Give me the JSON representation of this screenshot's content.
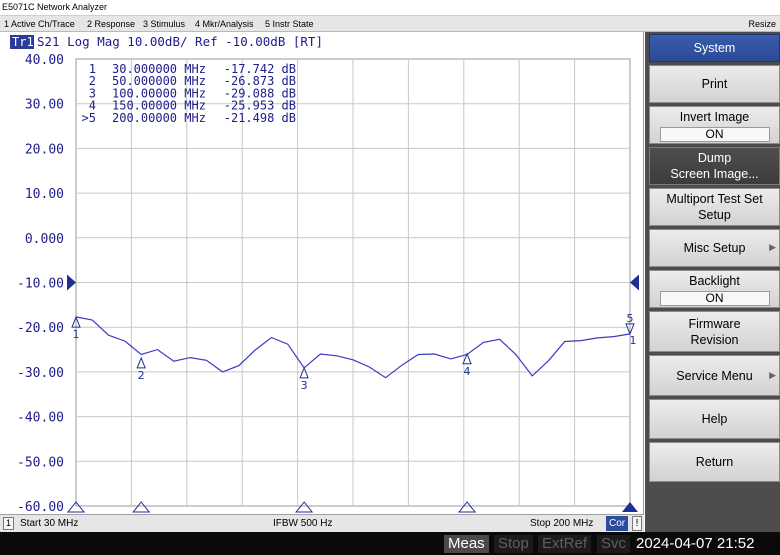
{
  "window": {
    "title": "E5071C Network Analyzer"
  },
  "menu": {
    "items": [
      "1 Active Ch/Trace",
      "2 Response",
      "3 Stimulus",
      "4 Mkr/Analysis",
      "5 Instr State"
    ],
    "resize_label": "Resize"
  },
  "trace": {
    "id_label": "Tr1",
    "header": "S21 Log Mag 10.00dB/ Ref -10.00dB [RT]"
  },
  "markers": [
    {
      "num": "1",
      "active": false,
      "freq": "30.000000 MHz",
      "value": "-17.742 dB",
      "freq_mhz": 30,
      "db": -17.742
    },
    {
      "num": "2",
      "active": false,
      "freq": "50.000000 MHz",
      "value": "-26.873 dB",
      "freq_mhz": 50,
      "db": -26.873
    },
    {
      "num": "3",
      "active": false,
      "freq": "100.00000 MHz",
      "value": "-29.088 dB",
      "freq_mhz": 100,
      "db": -29.088
    },
    {
      "num": "4",
      "active": false,
      "freq": "150.00000 MHz",
      "value": "-25.953 dB",
      "freq_mhz": 150,
      "db": -25.953
    },
    {
      "num": "5",
      "active": true,
      "freq": "200.00000 MHz",
      "value": "-21.498 dB",
      "freq_mhz": 200,
      "db": -21.498
    }
  ],
  "chart_data": {
    "type": "line",
    "title": "S21 Log Mag 10.00dB/ Ref -10.00dB [RT]",
    "xlabel": "",
    "ylabel": "",
    "xlim": [
      30,
      200
    ],
    "ylim": [
      -60,
      40
    ],
    "reference_level": -10,
    "y_ticks": [
      "40.00",
      "30.00",
      "20.00",
      "10.00",
      "0.000",
      "-10.00",
      "-20.00",
      "-30.00",
      "-40.00",
      "-50.00",
      "-60.00"
    ],
    "grid": true,
    "series": [
      {
        "color": "#3b3bc0",
        "x": [
          30,
          35,
          40,
          45,
          50,
          55,
          60,
          65,
          70,
          75,
          80,
          85,
          90,
          95,
          100,
          105,
          110,
          115,
          120,
          125,
          130,
          135,
          140,
          145,
          150,
          155,
          160,
          165,
          170,
          175,
          180,
          185,
          190,
          195,
          200
        ],
        "y": [
          -17.7,
          -18.4,
          -21.8,
          -23.1,
          -26.1,
          -25.0,
          -27.6,
          -26.8,
          -27.4,
          -30.0,
          -28.6,
          -25.1,
          -22.3,
          -23.8,
          -29.1,
          -26.0,
          -26.4,
          -27.3,
          -28.9,
          -31.3,
          -28.5,
          -26.1,
          -26.0,
          -27.1,
          -26.1,
          -23.4,
          -22.7,
          -26.1,
          -30.9,
          -27.5,
          -23.2,
          -23.0,
          -22.4,
          -22.1,
          -21.5
        ]
      }
    ]
  },
  "footer": {
    "channel": "1",
    "start": "Start 30 MHz",
    "ifbw": "IFBW 500 Hz",
    "stop": "Stop 200 MHz",
    "cor": "Cor",
    "alert": "!"
  },
  "status": {
    "meas": "Meas",
    "stop": "Stop",
    "extref": "ExtRef",
    "svc": "Svc",
    "datetime": "2024-04-07 21:52"
  },
  "softkeys": {
    "title": "System",
    "print": "Print",
    "invert_image": {
      "label": "Invert Image",
      "value": "ON"
    },
    "dump_line1": "Dump",
    "dump_line2": "Screen Image...",
    "multiport_line1": "Multiport Test Set",
    "multiport_line2": "Setup",
    "misc_setup": "Misc Setup",
    "backlight": {
      "label": "Backlight",
      "value": "ON"
    },
    "firmware_line1": "Firmware",
    "firmware_line2": "Revision",
    "service_menu": "Service Menu",
    "help": "Help",
    "return": "Return"
  },
  "colors": {
    "trace": "#3b3bc0",
    "axis_text": "#1c1c8c",
    "grid": "#c8c8c8",
    "softkey_header": "#2b4a95",
    "status_active": "#ffffff"
  }
}
